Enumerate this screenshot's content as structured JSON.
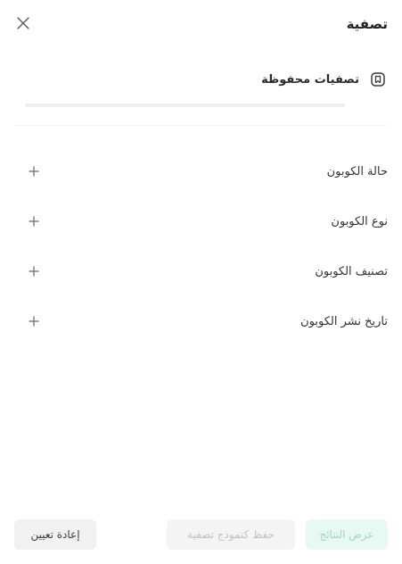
{
  "header": {
    "title": "تصفية"
  },
  "saved_filters": {
    "label": "تصفيات محفوظة"
  },
  "filters": [
    {
      "label": "حالة الكوبون"
    },
    {
      "label": "نوع الكوبون"
    },
    {
      "label": "تصنيف الكوبون"
    },
    {
      "label": "تاريخ نشر الكوبون"
    }
  ],
  "footer": {
    "show_results": "عرض النتائج",
    "save_as_template": "حفظ كنموذج تصفية",
    "reset": "إعادة تعيين"
  },
  "colors": {
    "accent_bg": "#e8f8f2",
    "accent_text": "#9fd9c4",
    "icon": "#3a3a3a"
  },
  "icons": {
    "close": "close-icon",
    "saved": "bookmark-icon",
    "expand": "plus-icon"
  }
}
